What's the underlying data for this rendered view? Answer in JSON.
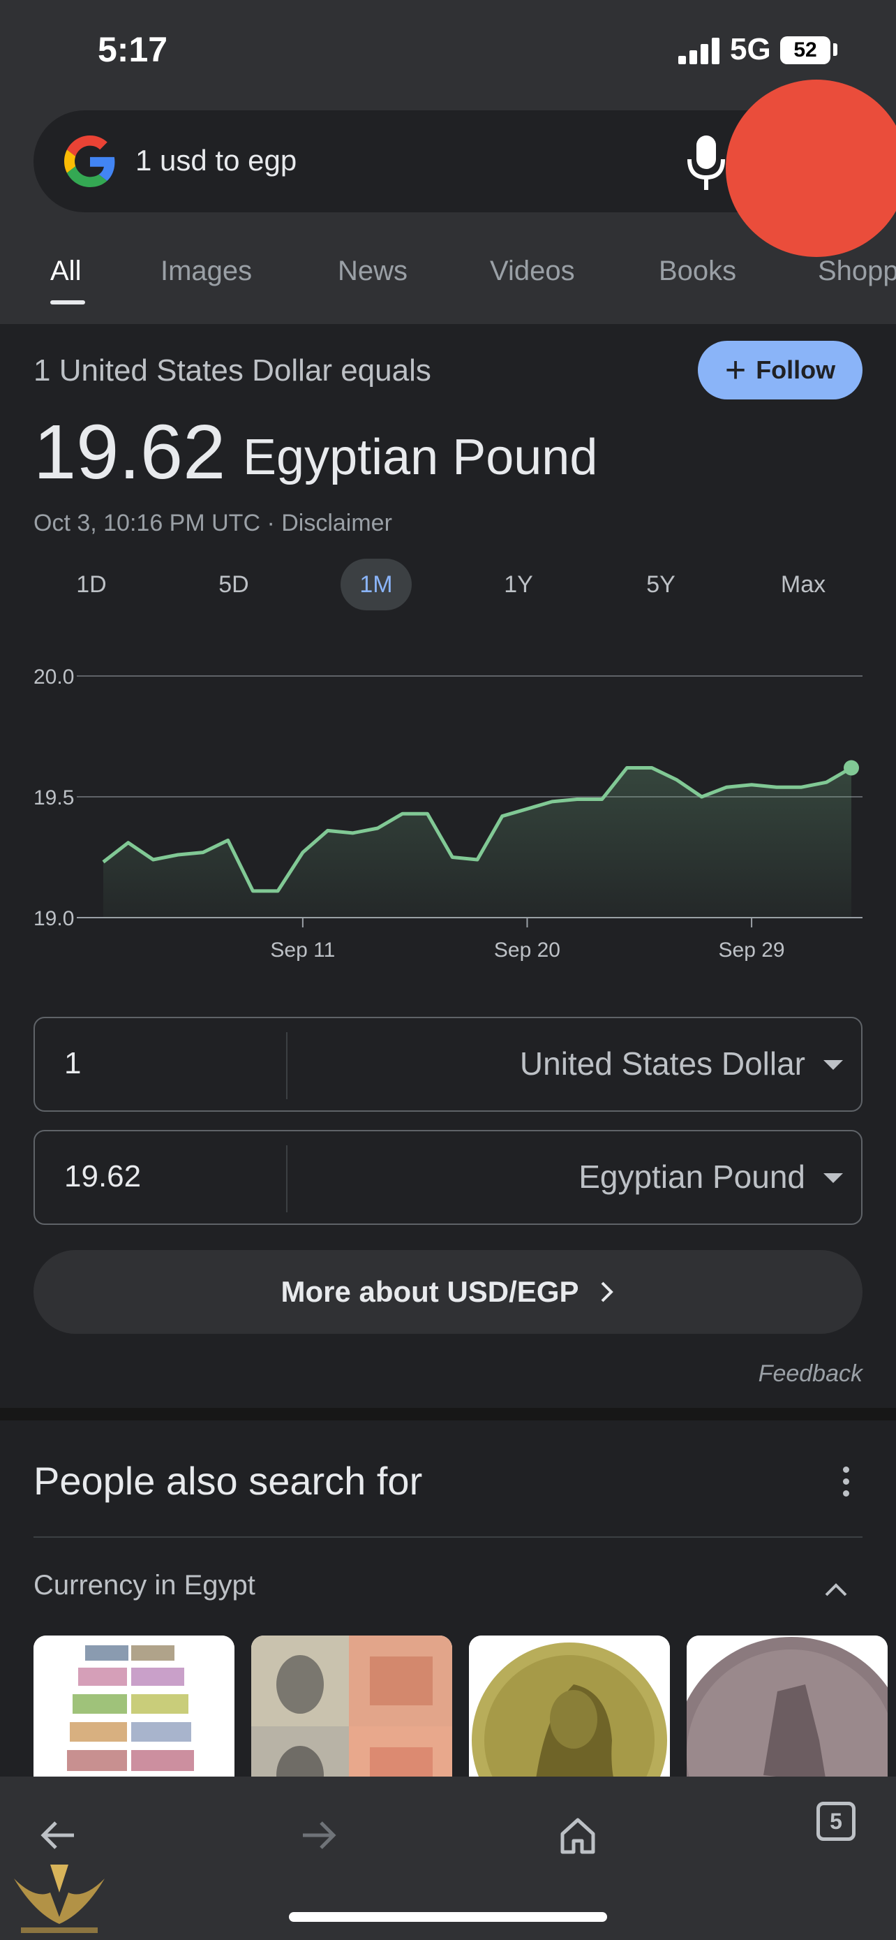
{
  "status": {
    "time": "5:17",
    "network": "5G",
    "battery": "52"
  },
  "search": {
    "query": "1 usd to egp"
  },
  "tabs": [
    {
      "label": "All"
    },
    {
      "label": "Images"
    },
    {
      "label": "News"
    },
    {
      "label": "Videos"
    },
    {
      "label": "Books"
    },
    {
      "label": "Shopp"
    }
  ],
  "result": {
    "equals_text": "1 United States Dollar equals",
    "follow_label": "Follow",
    "rate_value": "19.62",
    "rate_currency": "Egyptian Pound",
    "timestamp": "Oct 3, 10:16 PM UTC · Disclaimer"
  },
  "ranges": [
    "1D",
    "5D",
    "1M",
    "1Y",
    "5Y",
    "Max"
  ],
  "selected_range": "1M",
  "chart_data": {
    "type": "line",
    "y_ticks": [
      "20.0",
      "19.5",
      "19.0"
    ],
    "x_ticks": [
      "Sep 11",
      "Sep 20",
      "Sep 29"
    ],
    "ylim": [
      19.0,
      20.0
    ],
    "series": [
      {
        "values": [
          19.23,
          19.31,
          19.24,
          19.26,
          19.27,
          19.32,
          19.11,
          19.11,
          19.27,
          19.36,
          19.35,
          19.37,
          19.43,
          19.43,
          19.25,
          19.24,
          19.42,
          19.45,
          19.48,
          19.49,
          19.49,
          19.62,
          19.62,
          19.57,
          19.5,
          19.54,
          19.55,
          19.54,
          19.54,
          19.56,
          19.62
        ]
      }
    ],
    "colors": {
      "line": "#81c995"
    }
  },
  "converter": {
    "from": {
      "amount": "1",
      "unit": "United States Dollar"
    },
    "to": {
      "amount": "19.62",
      "unit": "Egyptian Pound"
    }
  },
  "more_label": "More about USD/EGP",
  "feedback": "Feedback",
  "pasf": {
    "title": "People also search for",
    "subtitle": "Currency in Egypt"
  },
  "bottom": {
    "tabs_count": "5"
  }
}
